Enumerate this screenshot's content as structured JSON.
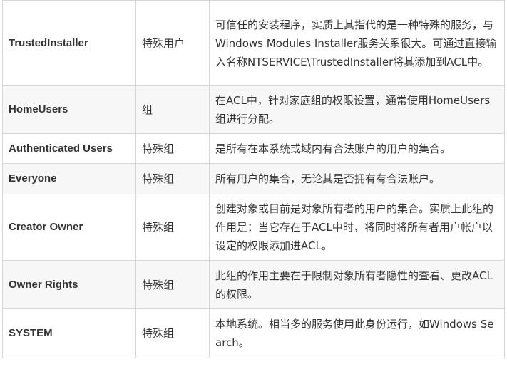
{
  "table": {
    "rows": [
      {
        "name": "TrustedInstaller",
        "type": "特殊用户",
        "description": "可信任的安装程序，实质上其指代的是一种特殊的服务，与Windows Modules Installer服务关系很大。可通过直接输入名称NTSERVICE\\TrustedInstaller将其添加到ACL中。"
      },
      {
        "name": "HomeUsers",
        "type": "组",
        "description": "在ACL中，针对家庭组的权限设置，通常使用HomeUsers组进行分配。"
      },
      {
        "name": "Authenticated Users",
        "type": "特殊组",
        "description": "是所有在本系统或域内有合法账户的用户的集合。"
      },
      {
        "name": "Everyone",
        "type": "特殊组",
        "description": "所有用户的集合，无论其是否拥有有合法账户。"
      },
      {
        "name": "Creator Owner",
        "type": "特殊组",
        "description": "创建对象或目前是对象所有者的用户的集合。实质上此组的作用是：当它存在于ACL中时，将同时将所有者用户帐户以设定的权限添加进ACL。"
      },
      {
        "name": "Owner Rights",
        "type": "特殊组",
        "description": "此组的作用主要在于限制对象所有者隐性的查看、更改ACL的权限。"
      },
      {
        "name": "SYSTEM",
        "type": "特殊组",
        "description": "本地系统。相当多的服务使用此身份运行，如Windows Search。"
      }
    ]
  }
}
